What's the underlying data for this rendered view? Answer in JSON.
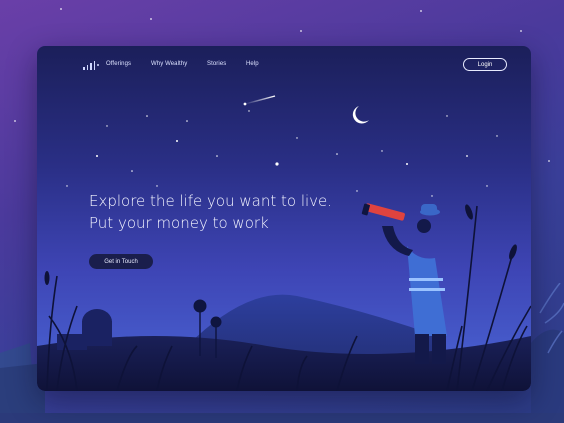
{
  "nav": {
    "logo_icon": "bar-chart-logo-icon",
    "links": [
      "Offerings",
      "Why Wealthy",
      "Stories",
      "Help"
    ],
    "login_label": "Login"
  },
  "hero": {
    "line1": "Explore the life you want to live.",
    "line2": "Put your money to work",
    "cta_label": "Get in Touch"
  },
  "colors": {
    "card_top": "#1b1f5a",
    "card_bottom": "#4a66d6",
    "cta_bg": "#1a1e4c",
    "page_bg": "#4b3a9c"
  },
  "illustration": {
    "icons": [
      "moon-icon",
      "shooting-star-icon",
      "telescope-icon",
      "observatory-icon",
      "palm-tree-icon",
      "grass-icon"
    ]
  }
}
